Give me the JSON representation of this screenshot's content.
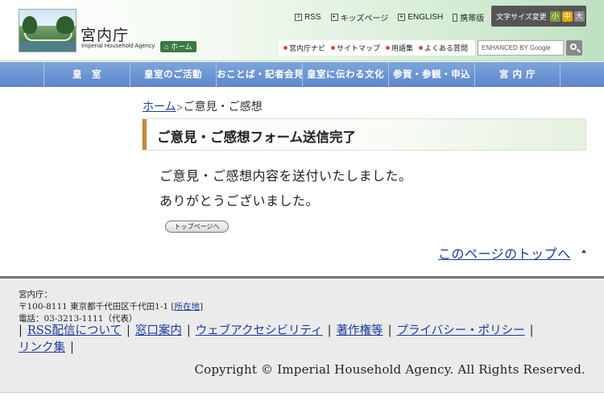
{
  "header": {
    "site_name": "宮内庁",
    "site_name_en": "Imperial Household Agency",
    "home_label": "ホーム",
    "util_links": [
      {
        "label": "RSS",
        "icon": "rss-icon"
      },
      {
        "label": "キッズページ",
        "icon": "arrow-box-icon"
      },
      {
        "label": "ENGLISH",
        "icon": "arrow-box-icon"
      },
      {
        "label": "携帯版",
        "icon": "mobile-icon"
      }
    ],
    "font_size": {
      "label": "文字サイズ変更",
      "small": "小",
      "medium": "中",
      "large": "大"
    },
    "sub_links": [
      "宮内庁ナビ",
      "サイトマップ",
      "用語集",
      "よくある質問"
    ],
    "search_placeholder": "ENHANCED BY Google"
  },
  "nav": {
    "items": [
      "皇　室",
      "皇室のご活動",
      "おことば・記者会見",
      "皇室に伝わる文化",
      "参賀・参観・申込",
      "宮 内 庁"
    ]
  },
  "breadcrumb": {
    "home": "ホーム",
    "separator": "＞",
    "current": "ご意見・ご感想"
  },
  "main": {
    "heading": "ご意見・ご感想フォーム送信完了",
    "message_1": "ご意見・ご感想内容を送付いたしました。",
    "message_2": "ありがとうございました。",
    "top_page_button": "トップページへ",
    "page_top_link": "このページのトップへ"
  },
  "footer": {
    "org": "宮内庁：",
    "address": "〒100-8111 東京都千代田区千代田1-1",
    "location_link": "所在地",
    "tel": "電話：03-3213-1111（代表）",
    "links": [
      "RSS配信について",
      "窓口案内",
      "ウェブアクセシビリティ",
      "著作権等",
      "プライバシー・ポリシー",
      "リンク集"
    ],
    "copyright": "Copyright © Imperial Household Agency. All Rights Reserved."
  },
  "colors": {
    "nav_blue": "#6b95d2",
    "link_blue": "#1a3a9e",
    "heading_accent": "#c48a3a",
    "home_green": "#3b7a43"
  }
}
